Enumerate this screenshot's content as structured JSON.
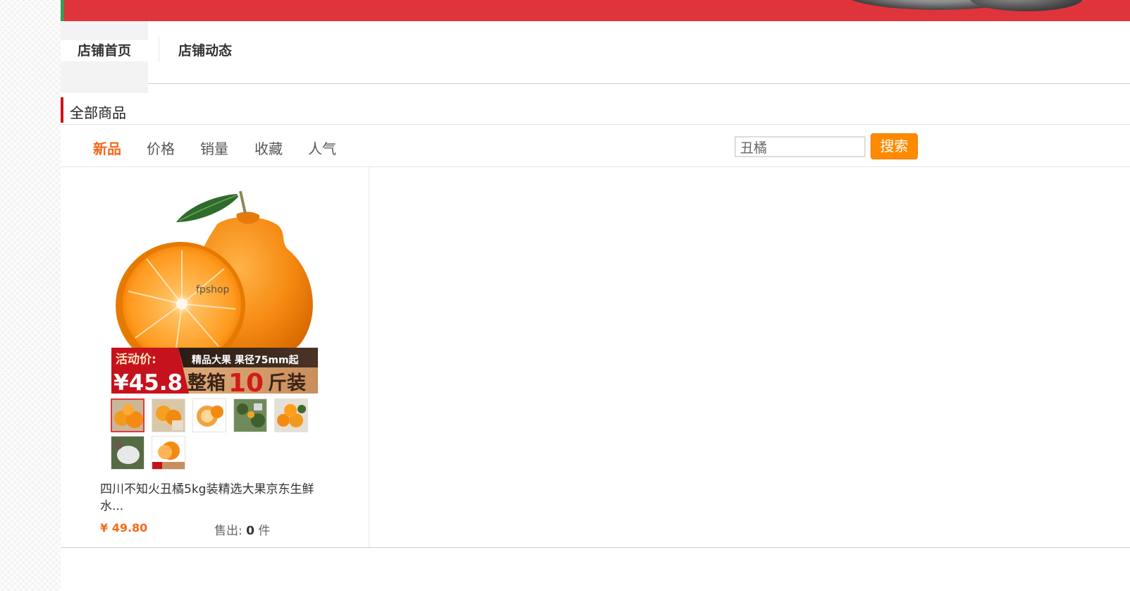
{
  "store_nav": {
    "home_label": "店铺首页",
    "dynamic_label": "店铺动态"
  },
  "section": {
    "title": "全部商品"
  },
  "sort_options": [
    "新品",
    "价格",
    "销量",
    "收藏",
    "人气"
  ],
  "sort_active_index": 0,
  "search": {
    "value": "丑橘",
    "button_label": "搜索"
  },
  "product": {
    "name": "四川不知火丑橘5kg装精选大果京东生鲜水...",
    "price": "¥ 49.80",
    "sold_label": "售出:",
    "sold_count": "0",
    "sold_unit": "件",
    "image": {
      "watermark": "fpshop",
      "promo_label": "活动价:",
      "promo_price": "¥45.8",
      "feature_text": "精品大果 果径75mm起",
      "pack_prefix": "整箱",
      "pack_number": "10",
      "pack_suffix": "斤装"
    },
    "thumbnail_count": 7
  },
  "colors": {
    "brand_red": "#e0343d",
    "accent_orange": "#f36a1a",
    "search_button": "#ff8a00",
    "section_bar": "#d0111b"
  }
}
